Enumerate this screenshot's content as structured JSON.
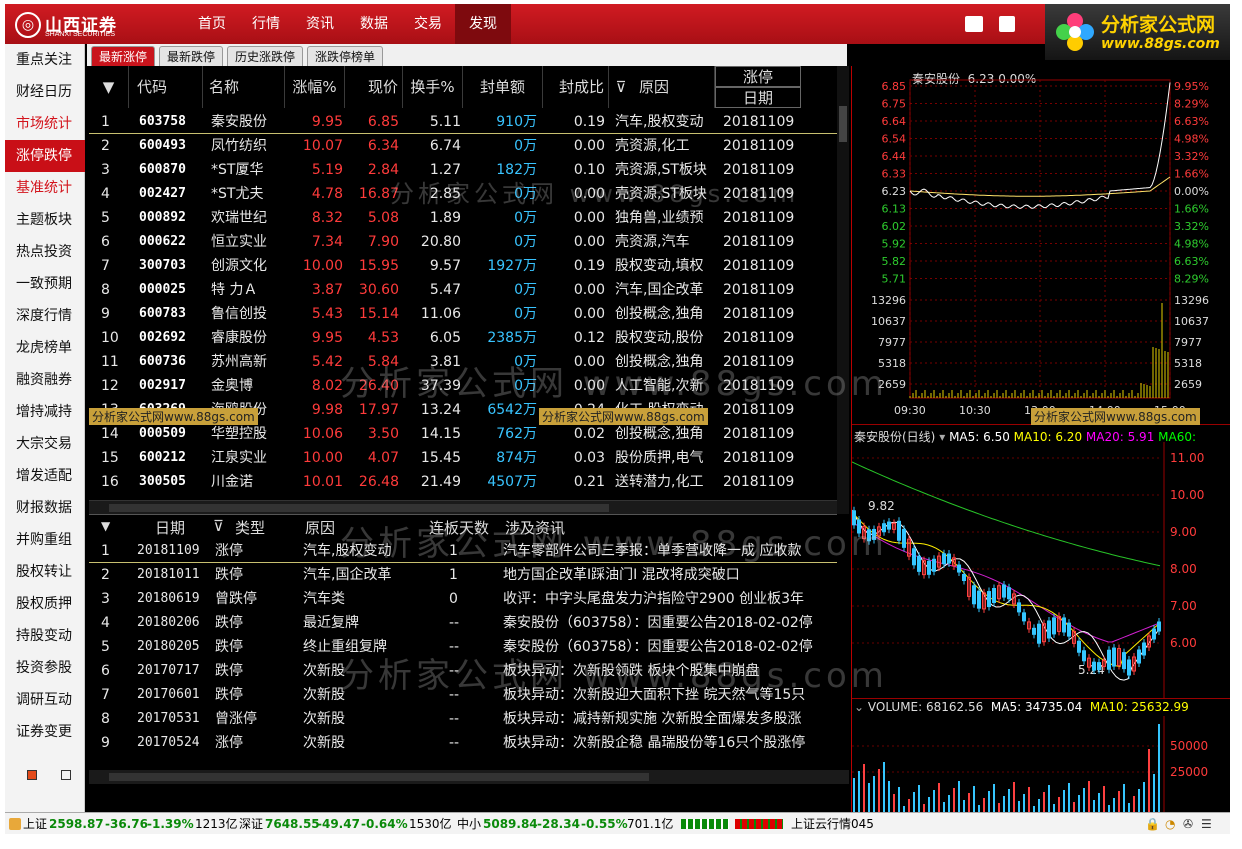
{
  "brand": {
    "logo_cn": "山西证券",
    "logo_en": "SHANXI SECURITIES",
    "wm_title": "分析家公式网",
    "wm_url": "www.88gs.com",
    "wm_tail": "关闭"
  },
  "menu": [
    "首页",
    "行情",
    "资讯",
    "数据",
    "交易",
    "发现"
  ],
  "sidebar": [
    "重点关注",
    "财经日历",
    "市场统计",
    "涨停跌停",
    "基准统计",
    "主题板块",
    "热点投资",
    "一致预期",
    "深度行情",
    "龙虎榜单",
    "融资融券",
    "增持减持",
    "大宗交易",
    "增发适配",
    "财报数据",
    "并购重组",
    "股权转让",
    "股权质押",
    "持股变动",
    "投资参股",
    "调研互动",
    "证券变更"
  ],
  "tabs": [
    "最新涨停",
    "最新跌停",
    "历史涨跌停",
    "涨跌停榜单"
  ],
  "table": {
    "headers": [
      "代码",
      "名称",
      "涨幅%",
      "现价",
      "换手%",
      "封单额",
      "封成比",
      "原因"
    ],
    "last_header_top": "涨停",
    "last_header_bottom": "日期",
    "filter_icon": "filter-icon",
    "rows": [
      {
        "n": "1",
        "code": "603758",
        "name": "秦安股份",
        "chg": "9.95",
        "price": "6.85",
        "turn": "5.11",
        "seal": "910",
        "unit": "万",
        "ratio": "0.19",
        "reason": "汽车,股权变动",
        "date": "20181109"
      },
      {
        "n": "2",
        "code": "600493",
        "name": "凤竹纺织",
        "chg": "10.07",
        "price": "6.34",
        "turn": "6.74",
        "seal": "0",
        "unit": "万",
        "ratio": "0.00",
        "reason": "壳资源,化工",
        "date": "20181109"
      },
      {
        "n": "3",
        "code": "600870",
        "name": "*ST厦华",
        "chg": "5.19",
        "price": "2.84",
        "turn": "1.27",
        "seal": "182",
        "unit": "万",
        "ratio": "0.10",
        "reason": "壳资源,ST板块",
        "date": "20181109"
      },
      {
        "n": "4",
        "code": "002427",
        "name": "*ST尤夫",
        "chg": "4.78",
        "price": "16.87",
        "turn": "2.85",
        "seal": "0",
        "unit": "万",
        "ratio": "0.00",
        "reason": "壳资源,ST板块",
        "date": "20181109"
      },
      {
        "n": "5",
        "code": "000892",
        "name": "欢瑞世纪",
        "chg": "8.32",
        "price": "5.08",
        "turn": "1.89",
        "seal": "0",
        "unit": "万",
        "ratio": "0.00",
        "reason": "独角兽,业绩预",
        "date": "20181109"
      },
      {
        "n": "6",
        "code": "000622",
        "name": "恒立实业",
        "chg": "7.34",
        "price": "7.90",
        "turn": "20.80",
        "seal": "0",
        "unit": "万",
        "ratio": "0.00",
        "reason": "壳资源,汽车",
        "date": "20181109"
      },
      {
        "n": "7",
        "code": "300703",
        "name": "创源文化",
        "chg": "10.00",
        "price": "15.95",
        "turn": "9.57",
        "seal": "1927",
        "unit": "万",
        "ratio": "0.19",
        "reason": "股权变动,填权",
        "date": "20181109"
      },
      {
        "n": "8",
        "code": "000025",
        "name": "特 力Ａ",
        "chg": "3.87",
        "price": "30.60",
        "turn": "5.47",
        "seal": "0",
        "unit": "万",
        "ratio": "0.00",
        "reason": "汽车,国企改革",
        "date": "20181109"
      },
      {
        "n": "9",
        "code": "600783",
        "name": "鲁信创投",
        "chg": "5.43",
        "price": "15.14",
        "turn": "11.06",
        "seal": "0",
        "unit": "万",
        "ratio": "0.00",
        "reason": "创投概念,独角",
        "date": "20181109"
      },
      {
        "n": "10",
        "code": "002692",
        "name": "睿康股份",
        "chg": "9.95",
        "price": "4.53",
        "turn": "6.05",
        "seal": "2385",
        "unit": "万",
        "ratio": "0.12",
        "reason": "股权变动,股份",
        "date": "20181109"
      },
      {
        "n": "11",
        "code": "600736",
        "name": "苏州高新",
        "chg": "5.42",
        "price": "5.84",
        "turn": "3.81",
        "seal": "0",
        "unit": "万",
        "ratio": "0.00",
        "reason": "创投概念,独角",
        "date": "20181109"
      },
      {
        "n": "12",
        "code": "002917",
        "name": "金奥博",
        "chg": "8.02",
        "price": "26.40",
        "turn": "37.39",
        "seal": "0",
        "unit": "万",
        "ratio": "0.00",
        "reason": "人工智能,次新",
        "date": "20181109"
      },
      {
        "n": "13",
        "code": "603269",
        "name": "海鸥股份",
        "chg": "9.98",
        "price": "17.97",
        "turn": "13.24",
        "seal": "6542",
        "unit": "万",
        "ratio": "0.24",
        "reason": "化工,股权变动",
        "date": "20181109"
      },
      {
        "n": "14",
        "code": "000509",
        "name": "华塑控股",
        "chg": "10.06",
        "price": "3.50",
        "turn": "14.15",
        "seal": "762",
        "unit": "万",
        "ratio": "0.02",
        "reason": "创投概念,独角",
        "date": "20181109"
      },
      {
        "n": "15",
        "code": "600212",
        "name": "江泉实业",
        "chg": "10.00",
        "price": "4.07",
        "turn": "15.45",
        "seal": "874",
        "unit": "万",
        "ratio": "0.03",
        "reason": "股份质押,电气",
        "date": "20181109"
      },
      {
        "n": "16",
        "code": "300505",
        "name": "川金诺",
        "chg": "10.01",
        "price": "26.48",
        "turn": "21.49",
        "seal": "4507",
        "unit": "万",
        "ratio": "0.21",
        "reason": "送转潜力,化工",
        "date": "20181109"
      }
    ]
  },
  "history": {
    "headers": [
      "日期",
      "类型",
      "原因",
      "连板天数",
      "涉及资讯"
    ],
    "rows": [
      {
        "n": "1",
        "date": "20181109",
        "type": "涨停",
        "reason": "汽车,股权变动",
        "days": "1",
        "news": "汽车零部件公司三季报：单季营收降一成 应收款"
      },
      {
        "n": "2",
        "date": "20181011",
        "type": "跌停",
        "reason": "汽车,国企改革",
        "days": "1",
        "news": "地方国企改革I踩油门I 混改将成突破口"
      },
      {
        "n": "3",
        "date": "20180619",
        "type": "曾跌停",
        "reason": "汽车类",
        "days": "0",
        "news": "收评：中字头尾盘发力沪指险守2900 创业板3年"
      },
      {
        "n": "4",
        "date": "20180206",
        "type": "跌停",
        "reason": "最近复牌",
        "days": "--",
        "news": "秦安股份（603758）：因重要公告2018-02-02停"
      },
      {
        "n": "5",
        "date": "20180205",
        "type": "跌停",
        "reason": "终止重组复牌",
        "days": "--",
        "news": "秦安股份（603758）：因重要公告2018-02-02停"
      },
      {
        "n": "6",
        "date": "20170717",
        "type": "跌停",
        "reason": "次新股",
        "days": "--",
        "news": "板块异动：次新股领跌 板块个股集中崩盘"
      },
      {
        "n": "7",
        "date": "20170601",
        "type": "跌停",
        "reason": "次新股",
        "days": "--",
        "news": "板块异动：次新股迎大面积下挫 皖天然气等15只"
      },
      {
        "n": "8",
        "date": "20170531",
        "type": "曾涨停",
        "reason": "次新股",
        "days": "--",
        "news": "板块异动：减持新规实施 次新股全面爆发多股涨"
      },
      {
        "n": "9",
        "date": "20170524",
        "type": "涨停",
        "reason": "次新股",
        "days": "--",
        "news": "板块异动：次新股企稳 晶瑞股份等16只个股涨停"
      }
    ]
  },
  "intraday": {
    "title": "秦安股份",
    "last": "6.23",
    "pct": "0.00%",
    "left_ticks": [
      "6.85",
      "6.75",
      "6.64",
      "6.54",
      "6.44",
      "6.33",
      "6.23",
      "6.13",
      "6.02",
      "5.92",
      "5.82",
      "5.71"
    ],
    "right_ticks": [
      "9.95%",
      "8.29%",
      "6.63%",
      "4.98%",
      "3.32%",
      "1.66%",
      "0.00%",
      "1.66%",
      "3.32%",
      "4.98%",
      "6.63%",
      "8.29%"
    ],
    "vol_ticks": [
      "13296",
      "10637",
      "7977",
      "5318",
      "2659"
    ],
    "time_ticks": [
      "09:30",
      "10:30",
      "13:00",
      "14:00",
      "15:00"
    ]
  },
  "daily": {
    "title": "秦安股份(日线)",
    "ma5": "MA5: 6.50",
    "ma10": "MA10: 6.20",
    "ma20": "MA20: 5.91",
    "ma60": "MA60:",
    "ticks": [
      "11.00",
      "10.00",
      "9.00",
      "8.00",
      "7.00",
      "6.00"
    ],
    "high_label": "9.82",
    "low_label": "5.24"
  },
  "volume": {
    "label": "VOLUME: 68162.56",
    "ma5": "MA5: 34735.04",
    "ma10": "MA10: 25632.99",
    "ticks": [
      "50000",
      "25000"
    ]
  },
  "status": {
    "sh_label": "上证",
    "sh_val": "2598.87",
    "sh_chg": "-36.76",
    "sh_pct": "-1.39%",
    "sh_amt": "1213亿",
    "sz_label": "深证",
    "sz_val": "7648.55",
    "sz_chg": "-49.47",
    "sz_pct": "-0.64%",
    "sz_amt": "1530亿",
    "zx_label": "中小",
    "zx_val": "5089.84",
    "zx_chg": "-28.34",
    "zx_pct": "-0.55%",
    "zx_amt": "701.1亿",
    "cloud": "上证云行情045"
  },
  "watermark": {
    "text1": "分析家公式网 www.88gs.com",
    "badge": "分析家公式网www.88gs.com"
  }
}
